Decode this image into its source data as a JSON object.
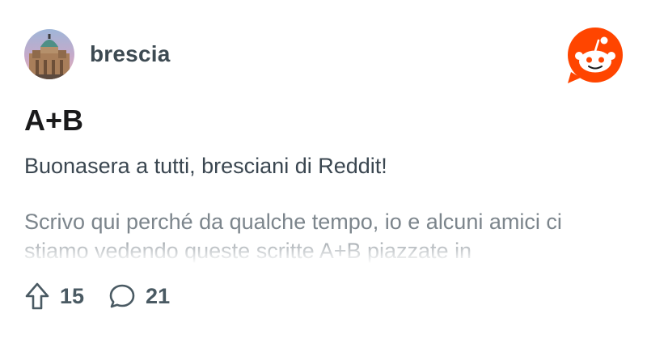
{
  "community": {
    "name": "brescia",
    "avatar": "brescia-cathedral-avatar"
  },
  "brand": {
    "logo": "reddit-logo",
    "accent_color": "#ff4500"
  },
  "post": {
    "title": "A+B",
    "greeting": "Buonasera a tutti, bresciani di Reddit!",
    "body": "Scrivo qui perché da qualche tempo, io e alcuni amici ci stiamo vedendo queste scritte A+B piazzate in"
  },
  "actions": {
    "upvote_icon": "upvote-arrow-icon",
    "upvotes": "15",
    "comment_icon": "comment-bubble-icon",
    "comments": "21"
  }
}
